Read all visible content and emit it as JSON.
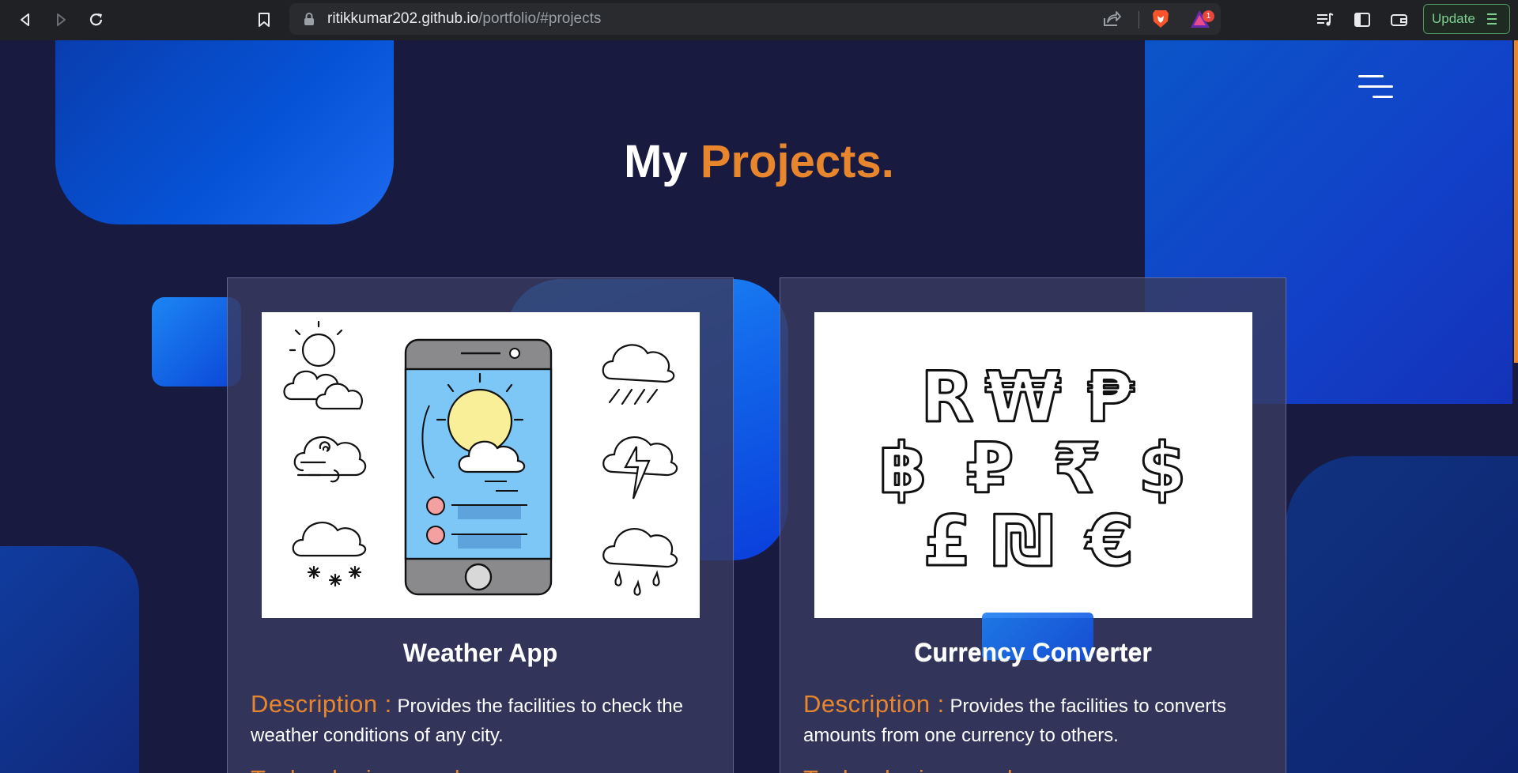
{
  "browser": {
    "url_host": "ritikkumar202.github.io",
    "url_path": "/portfolio/#projects",
    "rewards_badge": "1",
    "update_label": "Update"
  },
  "page": {
    "title_main": "My",
    "title_accent": "Projects.",
    "accent_color": "#e8862e",
    "background_color": "#181a3f"
  },
  "projects": [
    {
      "name": "Weather App",
      "description_label": "Description :",
      "description_text": "Provides the facilities to check the weather conditions of any city.",
      "tech_label": "Technologies used :",
      "image_icon": "weather-illustration"
    },
    {
      "name": "Currency Converter",
      "description_label": "Description :",
      "description_text": "Provides the facilities to converts amounts from one currency to others.",
      "tech_label": "Technologies used :",
      "image_icon": "currency-symbols-illustration",
      "currency_symbols": [
        "R",
        "₩",
        "₱",
        "฿",
        "₽",
        "₹",
        "$",
        "£",
        "₪",
        "€"
      ]
    }
  ]
}
